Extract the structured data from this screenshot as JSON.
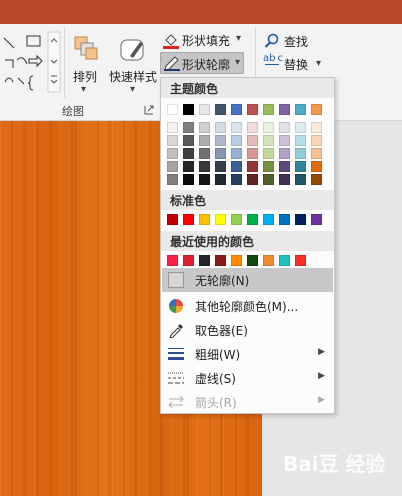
{
  "ribbon": {
    "arrange_label": "排列",
    "quick_styles_label": "快速样式",
    "shape_fill_label": "形状填充",
    "shape_outline_label": "形状轮廓",
    "find_label": "查找",
    "replace_label": "替换",
    "drawing_group_label": "绘图",
    "replace_icon_text": "ab c"
  },
  "menu": {
    "theme_colors_label": "主题颜色",
    "standard_colors_label": "标准色",
    "recent_colors_label": "最近使用的颜色",
    "no_outline_label": "无轮廓(N)",
    "more_colors_label": "其他轮廓颜色(M)...",
    "eyedropper_label": "取色器(E)",
    "weight_label": "粗细(W)",
    "dashes_label": "虚线(S)",
    "arrows_label": "箭头(R)",
    "submenu_arrow": "▶"
  },
  "colors": {
    "theme_top": [
      "#ffffff",
      "#000000",
      "#e7e6e6",
      "#44546a",
      "#4472c4",
      "#c0504d",
      "#9bbb59",
      "#8064a2",
      "#4bacc6",
      "#f79646"
    ],
    "theme_shades": [
      [
        "#f2f2f2",
        "#7f7f7f",
        "#d0cece",
        "#d6dce4",
        "#dbe5f1",
        "#f2dcdb",
        "#ebf1dd",
        "#e5e0ec",
        "#dbeef3",
        "#fde9d9"
      ],
      [
        "#d8d8d8",
        "#595959",
        "#aeabab",
        "#adb9ca",
        "#b8cce4",
        "#e5b9b7",
        "#d7e3bc",
        "#ccc1d9",
        "#b7dde8",
        "#fbd5b5"
      ],
      [
        "#bfbfbf",
        "#3f3f3f",
        "#757070",
        "#8496b0",
        "#95b3d7",
        "#d99694",
        "#c3d69b",
        "#b2a2c7",
        "#92cddc",
        "#fac08f"
      ],
      [
        "#a5a5a5",
        "#262626",
        "#3a3838",
        "#323f4f",
        "#366092",
        "#953734",
        "#76923c",
        "#5f497a",
        "#31859b",
        "#e36c09"
      ],
      [
        "#7f7f7f",
        "#0c0c0c",
        "#171616",
        "#222a35",
        "#244061",
        "#632423",
        "#4f6128",
        "#3f3151",
        "#205867",
        "#974806"
      ]
    ],
    "standard": [
      "#c00000",
      "#ff0000",
      "#ffc000",
      "#ffff00",
      "#92d050",
      "#00b050",
      "#00b0f0",
      "#0070c0",
      "#002060",
      "#7030a0"
    ],
    "recent": [
      "#ff1f4b",
      "#e02030",
      "#252525",
      "#8b1a1a",
      "#ff8c00",
      "#0e4a0e",
      "#f08a30",
      "#20c0c0",
      "#ff2a2a"
    ]
  },
  "watermark": "Bai豆 经验"
}
